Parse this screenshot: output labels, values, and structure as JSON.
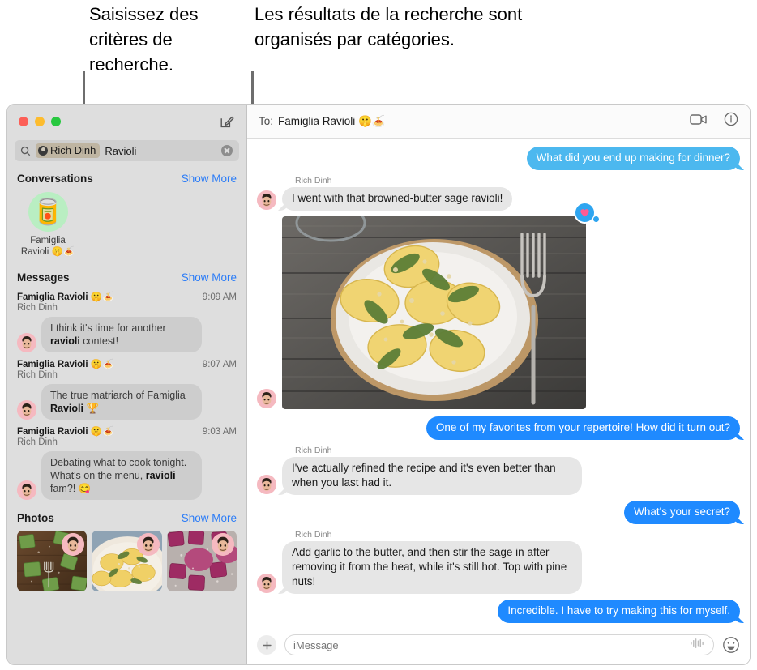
{
  "callouts": {
    "left": "Saisissez des critères de recherche.",
    "right": "Les résultats de la recherche sont organisés par catégories."
  },
  "sidebar": {
    "window_controls": [
      "close",
      "minimize",
      "zoom"
    ],
    "compose_icon": "compose-icon",
    "search": {
      "icon": "search-icon",
      "token_label": "Rich Dinh",
      "token_icon": "person-icon",
      "text": "Ravioli",
      "placeholder": "Search",
      "clear_icon": "clear-icon"
    },
    "sections": {
      "conversations": {
        "title": "Conversations",
        "show_more": "Show More",
        "items": [
          {
            "emoji": "🥫",
            "name": "Famiglia Ravioli 🤫🍝"
          }
        ]
      },
      "messages": {
        "title": "Messages",
        "show_more": "Show More",
        "results": [
          {
            "chat": "Famiglia Ravioli 🤫🍝",
            "sender": "Rich Dinh",
            "time": "9:09 AM",
            "pre": "I think it's time for another ",
            "match": "ravioli",
            "post": " contest!"
          },
          {
            "chat": "Famiglia Ravioli 🤫🍝",
            "sender": "Rich Dinh",
            "time": "9:07 AM",
            "pre": "The true matriarch of Famiglia ",
            "match": "Ravioli",
            "post": " 🏆"
          },
          {
            "chat": "Famiglia Ravioli 🤫🍝",
            "sender": "Rich Dinh",
            "time": "9:03 AM",
            "pre": "Debating what to cook tonight. What's on the menu, ",
            "match": "ravioli",
            "post": " fam?! 😋"
          }
        ]
      },
      "photos": {
        "title": "Photos",
        "show_more": "Show More",
        "items": [
          {
            "alt": "green spinach ravioli on wooden board with fork"
          },
          {
            "alt": "yellow ravioli with sage on plate"
          },
          {
            "alt": "purple beet ravioli dusted with flour"
          }
        ]
      }
    }
  },
  "thread": {
    "to_label": "To:",
    "to_name": "Famiglia Ravioli 🤫🍝",
    "facetime_icon": "video-camera-icon",
    "info_icon": "info-icon",
    "messages": [
      {
        "kind": "out",
        "style": "light",
        "text": "What did you end up making for dinner?"
      },
      {
        "kind": "in",
        "sender": "Rich Dinh",
        "text": "I went with that browned-butter sage ravioli!"
      },
      {
        "kind": "photo",
        "sender": "",
        "alt": "Plate of browned-butter sage ravioli with pine nuts on a rustic wooden table next to a fork",
        "tapback": "heart"
      },
      {
        "kind": "out",
        "style": "solid",
        "text": "One of my favorites from your repertoire! How did it turn out?"
      },
      {
        "kind": "in",
        "sender": "Rich Dinh",
        "text": "I've actually refined the recipe and it's even better than when you last had it."
      },
      {
        "kind": "out",
        "style": "solid",
        "text": "What's your secret?"
      },
      {
        "kind": "in",
        "sender": "Rich Dinh",
        "text": "Add garlic to the butter, and then stir the sage in after removing it from the heat, while it's still hot. Top with pine nuts!"
      },
      {
        "kind": "out",
        "style": "solid",
        "text": "Incredible. I have to try making this for myself."
      }
    ],
    "composer": {
      "plus_icon": "plus-icon",
      "placeholder": "iMessage",
      "value": "",
      "audio_icon": "audio-waveform-icon",
      "emoji_icon": "emoji-smiley-icon"
    }
  },
  "colors": {
    "bubble_sent": "#1f8aff",
    "bubble_sent_light": "#4cb8ef",
    "bubble_received": "#e6e6e6",
    "link": "#2b7cf7",
    "sidebar_bg": "#dedede",
    "token_bg": "#bfb5a2"
  }
}
